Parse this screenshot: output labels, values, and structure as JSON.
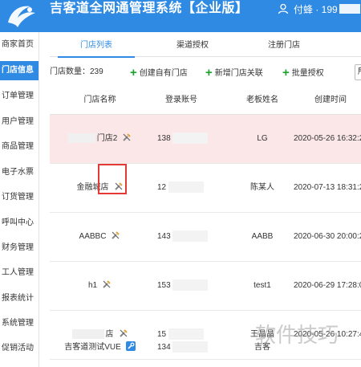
{
  "header": {
    "title": "吉客道全网通管理系统【企业版】",
    "user_name": "付蜂 · 199",
    "bg_color": "#2f8ae3"
  },
  "sidebar": {
    "items": [
      {
        "label": "商家首页",
        "active": false
      },
      {
        "label": "门店信息",
        "active": true
      },
      {
        "label": "订单管理",
        "active": false
      },
      {
        "label": "用户管理",
        "active": false
      },
      {
        "label": "商品管理",
        "active": false
      },
      {
        "label": "电子水票",
        "active": false
      },
      {
        "label": "订货管理",
        "active": false
      },
      {
        "label": "呼叫中心",
        "active": false
      },
      {
        "label": "财务管理",
        "active": false
      },
      {
        "label": "工人管理",
        "active": false
      },
      {
        "label": "报表统计",
        "active": false
      },
      {
        "label": "系统管理",
        "active": false
      },
      {
        "label": "促销活动",
        "active": false
      }
    ]
  },
  "tabs": [
    {
      "label": "门店列表",
      "active": true
    },
    {
      "label": "渠道授权",
      "active": false
    },
    {
      "label": "注册门店",
      "active": false
    }
  ],
  "toolbar": {
    "count_label": "门店数量：239",
    "create_own": "创建自有门店",
    "add_link": "新增门店关联",
    "batch_auth": "批量授权",
    "select_value": "所"
  },
  "table": {
    "columns": [
      "门店名称",
      "登录账号",
      "老板姓名",
      "创建时间"
    ],
    "rows": [
      {
        "name": "门店2",
        "account": "138",
        "boss": "LG",
        "created": "2020-05-26 16:32:2",
        "icon": "wrench-icon",
        "highlighted": true
      },
      {
        "name": "金融城店",
        "account": "12",
        "boss": "陈某人",
        "created": "2020-07-13 18:31:2",
        "icon": "wrench-icon",
        "highlighted": false
      },
      {
        "name": "AABBC",
        "account": "143",
        "boss": "AABB",
        "created": "2020-06-30 20:00:2",
        "icon": "wrench-icon",
        "highlighted": false
      },
      {
        "name": "h1",
        "account": "153",
        "boss": "test1",
        "created": "2020-06-29 17:28:0",
        "icon": "wrench-icon",
        "highlighted": false
      },
      {
        "name": "店",
        "account": "15",
        "boss": "王晶晶",
        "created": "2020-05-26 10:27:4",
        "icon": "wrench-icon",
        "highlighted": false
      },
      {
        "name": "吉客道测试VUE",
        "account": "134",
        "boss": "吉客",
        "created": "",
        "icon": "wrench-blue-icon",
        "highlighted": false
      }
    ]
  },
  "watermark": "软件技巧",
  "colors": {
    "accent": "#2f8ae3",
    "add_green": "#1ba12c",
    "highlight_row": "#fbe7e7",
    "annotation_red": "#e53935"
  }
}
